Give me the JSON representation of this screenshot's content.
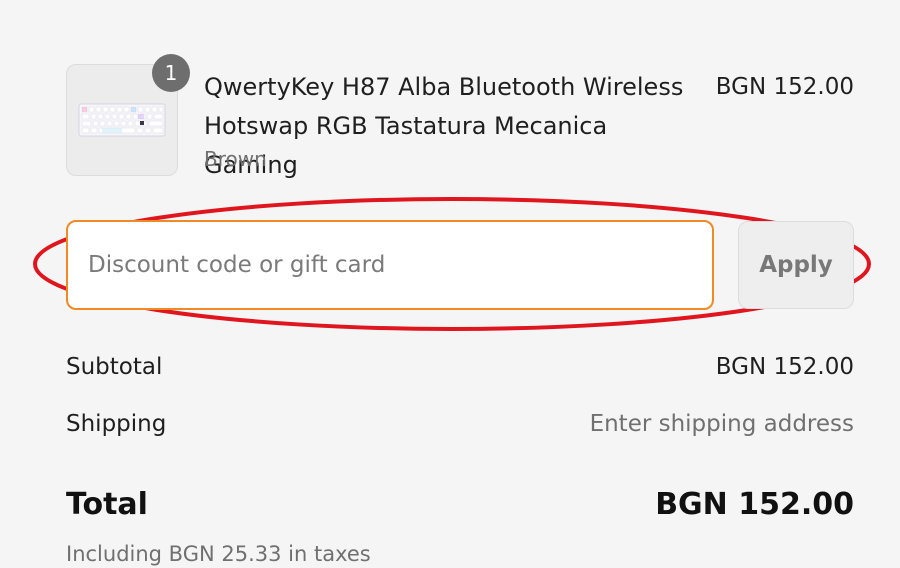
{
  "line_item": {
    "quantity": "1",
    "name": "QwertyKey H87 Alba Bluetooth Wireless Hotswap RGB Tastatura Mecanica Gaming",
    "variant": "Brown",
    "price": "BGN 152.00",
    "thumbnail_icon": "keyboard-icon"
  },
  "discount": {
    "placeholder": "Discount code or gift card",
    "value": "",
    "apply_label": "Apply",
    "highlight_color": "#e0161e",
    "focus_color": "#f08a24"
  },
  "summary": {
    "subtotal_label": "Subtotal",
    "subtotal_value": "BGN 152.00",
    "shipping_label": "Shipping",
    "shipping_value": "Enter shipping address",
    "total_label": "Total",
    "total_value": "BGN 152.00",
    "taxes_note": "Including BGN 25.33 in taxes"
  }
}
